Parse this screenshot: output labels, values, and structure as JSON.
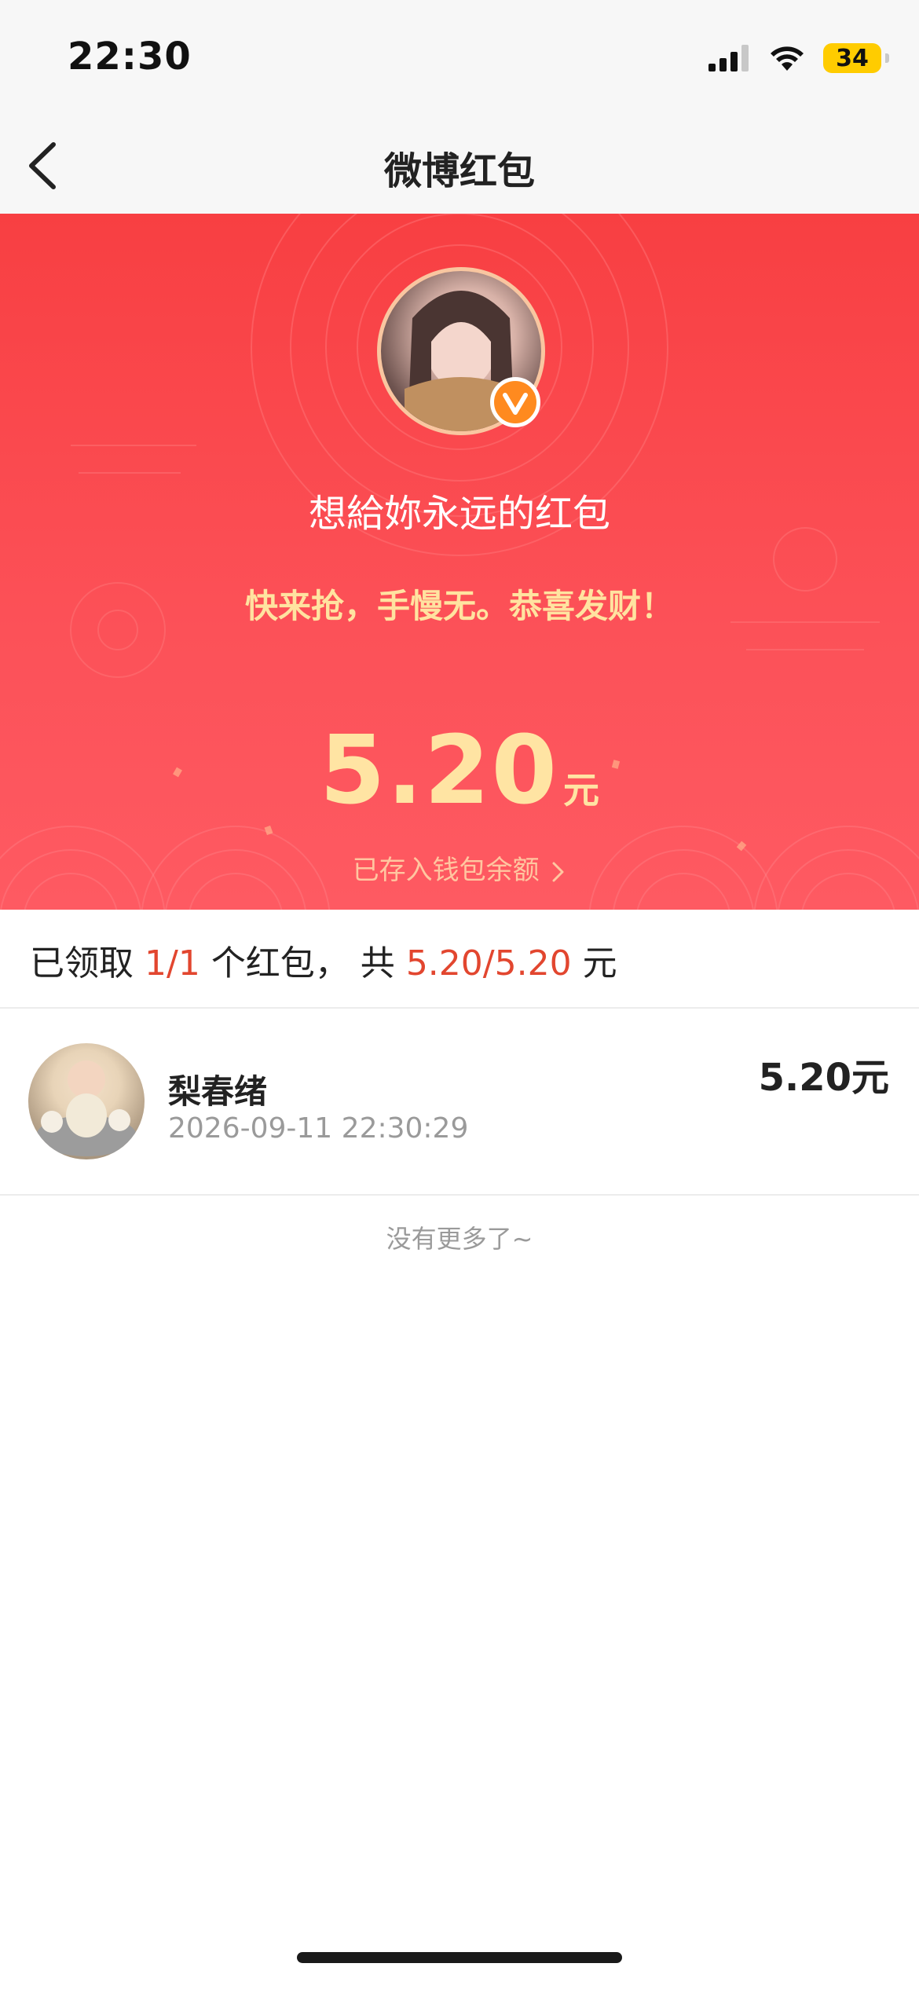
{
  "status_bar": {
    "time": "22:30",
    "battery": "34",
    "icons": [
      "cellular-signal-icon",
      "wifi-icon",
      "battery-icon"
    ]
  },
  "navbar": {
    "title": "微博红包",
    "back_icon": "chevron-left-icon"
  },
  "hero": {
    "greeting": "想給妳永远的红包",
    "blessing": "快来抢，手慢无。恭喜发财！",
    "amount": "5.20",
    "unit": "元",
    "saved_label": "已存入钱包余额",
    "saved_arrow_icon": "chevron-right-icon",
    "accent_color": "#fa4a4f",
    "gold_color": "#ffe3a0"
  },
  "summary": {
    "prefix": "已领取",
    "count": "1/1",
    "middle": "个红包，  共",
    "total": "5.20/5.20",
    "suffix": "元",
    "highlight_color": "#e2462f"
  },
  "records": [
    {
      "name": "梨春绪",
      "time": "2026-09-11 22:30:29",
      "amount": "5.20元"
    }
  ],
  "footer": {
    "no_more": "没有更多了~"
  }
}
